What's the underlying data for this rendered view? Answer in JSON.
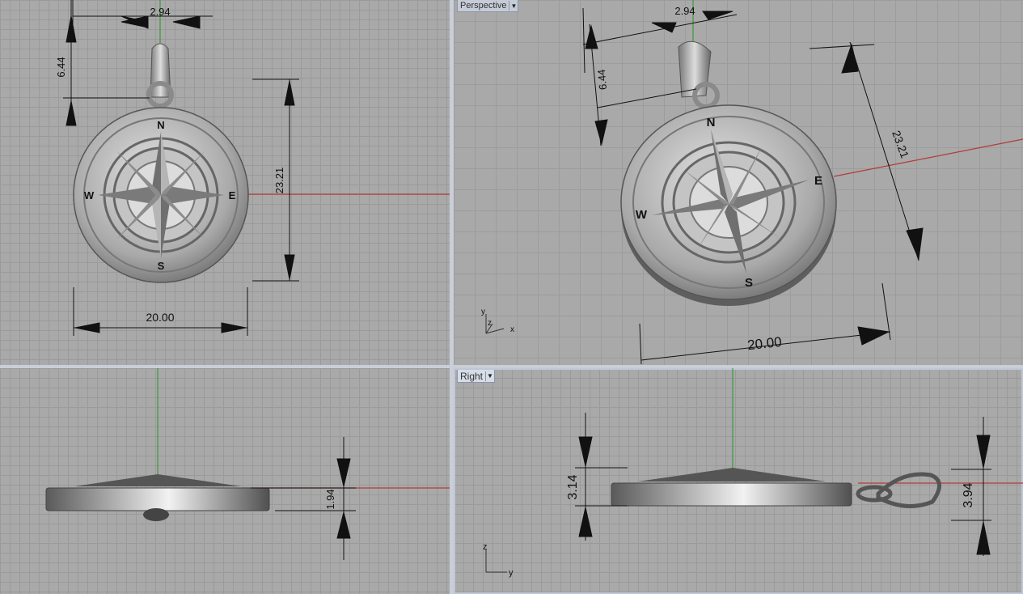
{
  "viewports": {
    "top": {
      "dimensions": {
        "bail_width": "2.94",
        "bail_height": "6.44",
        "total_height": "23.21",
        "diameter": "20.00"
      }
    },
    "perspective": {
      "label": "Perspective",
      "dimensions": {
        "bail_width": "2.94",
        "bail_height": "6.44",
        "total_height": "23.21",
        "diameter": "20.00"
      }
    },
    "front": {
      "dimensions": {
        "thickness": "1.94"
      }
    },
    "right": {
      "label": "Right",
      "dimensions": {
        "star_height": "3.14",
        "bail_thickness": "3.94"
      }
    }
  },
  "compass": {
    "north": "N",
    "south": "S",
    "east": "E",
    "west": "W"
  },
  "axes": {
    "x": "x",
    "y": "y",
    "z": "z"
  },
  "colors": {
    "grid_bg": "#a9a9a9",
    "x_axis": "#b33a3a",
    "y_axis": "#3a9a3a",
    "divider": "#c9ced8"
  }
}
